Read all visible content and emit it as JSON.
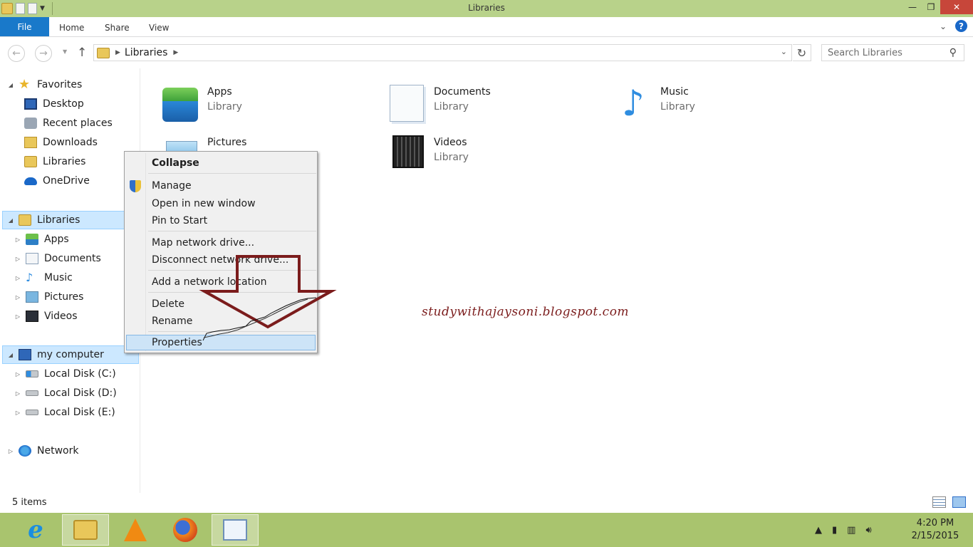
{
  "window": {
    "title": "Libraries",
    "controls": {
      "minimize": "—",
      "maximize": "❐",
      "close": "✕"
    }
  },
  "ribbon": {
    "file": "File",
    "tabs": [
      "Home",
      "Share",
      "View"
    ]
  },
  "address": {
    "path": "Libraries",
    "search_placeholder": "Search Libraries"
  },
  "nav": {
    "favorites": {
      "label": "Favorites",
      "items": [
        "Desktop",
        "Recent places",
        "Downloads",
        "Libraries",
        "OneDrive"
      ]
    },
    "libraries": {
      "label": "Libraries",
      "items": [
        "Apps",
        "Documents",
        "Music",
        "Pictures",
        "Videos"
      ]
    },
    "computer": {
      "label": "my computer",
      "items": [
        "Local Disk (C:)",
        "Local Disk (D:)",
        "Local Disk (E:)"
      ]
    },
    "network": {
      "label": "Network"
    }
  },
  "content": {
    "libraries": [
      {
        "name": "Apps",
        "type": "Library"
      },
      {
        "name": "Documents",
        "type": "Library"
      },
      {
        "name": "Music",
        "type": "Library"
      },
      {
        "name": "Pictures",
        "type": ""
      },
      {
        "name": "Videos",
        "type": "Library"
      }
    ]
  },
  "context_menu": {
    "items": [
      "Collapse",
      "Manage",
      "Open in new window",
      "Pin to Start",
      "Map network drive...",
      "Disconnect network drive...",
      "Add a network location",
      "Delete",
      "Rename",
      "Properties"
    ],
    "highlighted": "Properties"
  },
  "watermark": "studywithajaysoni.blogspot.com",
  "status": {
    "items": "5 items"
  },
  "taskbar": {
    "time": "4:20 PM",
    "date": "2/15/2015"
  },
  "colors": {
    "titlebar": "#b8d28a",
    "file_tab": "#1979ca",
    "close_button": "#c7463a",
    "selection": "#cce8ff",
    "taskbar": "#a9c46e",
    "annotation_arrow": "#7b1c1c"
  }
}
